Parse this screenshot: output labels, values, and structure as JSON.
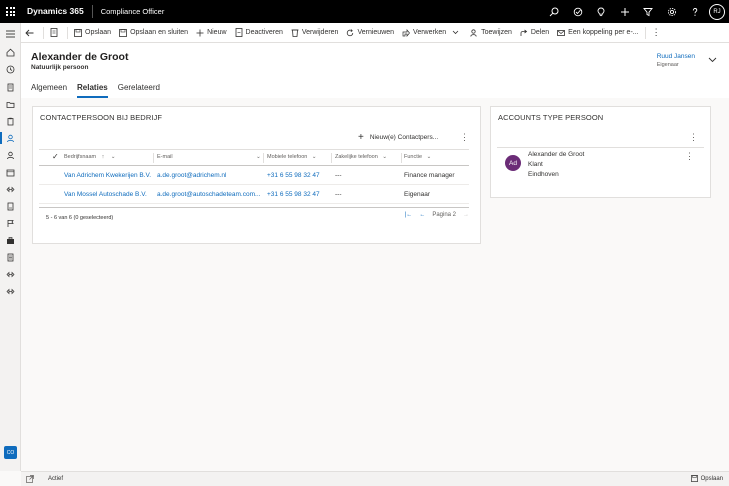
{
  "topbar": {
    "brand": "Dynamics 365",
    "app_name": "Compliance Officer",
    "user_initials": "RJ"
  },
  "commands": {
    "save": "Opslaan",
    "save_close": "Opslaan en sluiten",
    "new": "Nieuw",
    "deactivate": "Deactiveren",
    "delete": "Verwijderen",
    "refresh": "Vernieuwen",
    "process": "Verwerken",
    "assign": "Toewijzen",
    "share": "Delen",
    "email_link": "Een koppeling per e-..."
  },
  "record": {
    "title": "Alexander de Groot",
    "subtitle": "Natuurlijk persoon",
    "owner_name": "Ruud Jansen",
    "owner_label": "Eigenaar"
  },
  "tabs": [
    "Algemeen",
    "Relaties",
    "Gerelateerd"
  ],
  "contact_card": {
    "title": "CONTACTPERSOON BIJ BEDRIJF",
    "new_button": "Nieuw(e) Contactpers...",
    "columns": [
      "Bedrijfsnaam",
      "E-mail",
      "Mobiele telefoon",
      "Zakelijke telefoon",
      "Functie"
    ],
    "rows": [
      [
        "Van Adrichem Kwekerijen B.V.",
        "a.de.groot@adrichem.nl",
        "+31 6 55 98 32 47",
        "---",
        "Finance manager"
      ],
      [
        "Van Mossel Autoschade B.V.",
        "a.de.groot@autoschadeteam.com...",
        "+31 6 55 98 32 47",
        "---",
        "Eigenaar"
      ]
    ],
    "footer_count": "5 - 6 van 6 (0 geselecteerd)",
    "page_label": "Pagina 2"
  },
  "accounts_card": {
    "title": "ACCOUNTS TYPE PERSOON",
    "avatar_initials": "Ad",
    "name": "Alexander de Groot",
    "type": "Klant",
    "city": "Eindhoven"
  },
  "statusbar": {
    "status": "Actief",
    "save": "Opslaan"
  },
  "nav": {
    "badge": "CO"
  },
  "colors": {
    "accent": "#0f6cbd",
    "topbar": "#000000",
    "avatar": "#6b2c77"
  }
}
